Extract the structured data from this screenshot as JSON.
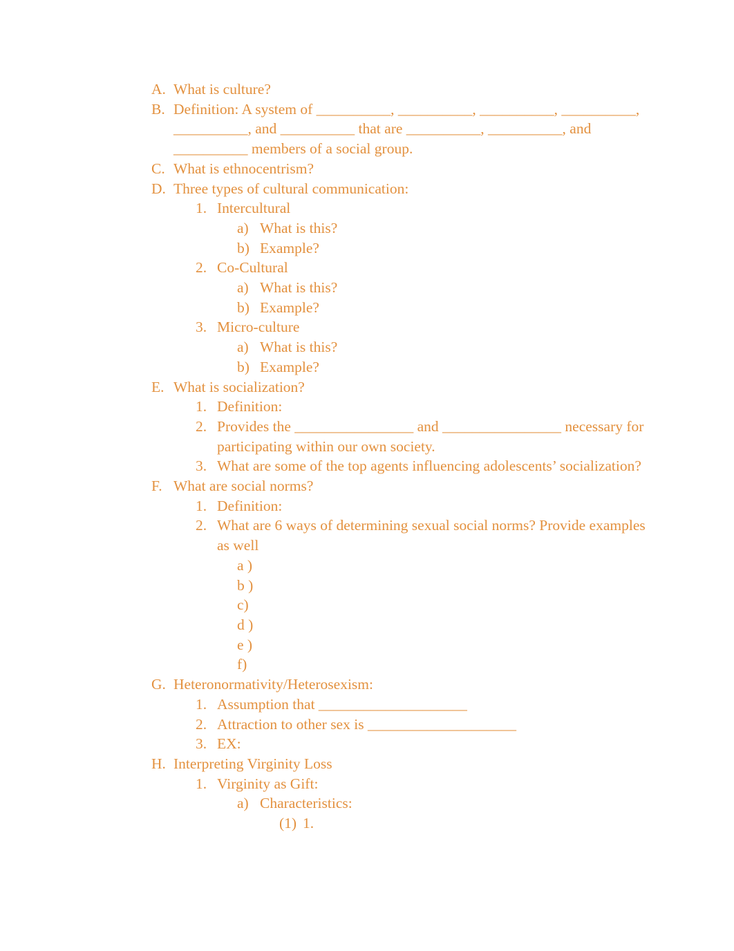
{
  "document": {
    "text_color": "#e3913f",
    "background_color": "#ffffff",
    "blanks": {
      "short": "__________",
      "medium": "________________",
      "long": "____________________"
    },
    "items": [
      {
        "level": 1,
        "marker": "A.",
        "text": "What is culture?"
      },
      {
        "level": 1,
        "marker": "B.",
        "text": "Definition: A system of __________, __________, __________, __________, __________, and __________  that are __________, __________, and __________ members of a social group."
      },
      {
        "level": 1,
        "marker": "C.",
        "text": "What is ethnocentrism?"
      },
      {
        "level": 1,
        "marker": "D.",
        "text": "Three types of cultural communication:"
      },
      {
        "level": 2,
        "marker": "1.",
        "text": "Intercultural"
      },
      {
        "level": 3,
        "marker": "a)",
        "text": "What is this?"
      },
      {
        "level": 3,
        "marker": "b)",
        "text": "Example?"
      },
      {
        "level": 2,
        "marker": "2.",
        "text": "Co-Cultural"
      },
      {
        "level": 3,
        "marker": "a)",
        "text": "What is this?"
      },
      {
        "level": 3,
        "marker": "b)",
        "text": "Example?"
      },
      {
        "level": 2,
        "marker": "3.",
        "text": " Micro-culture"
      },
      {
        "level": 3,
        "marker": "a)",
        "text": "What is this?"
      },
      {
        "level": 3,
        "marker": "b)",
        "text": "Example?"
      },
      {
        "level": 1,
        "marker": "E.",
        "text": "What is socialization?"
      },
      {
        "level": 2,
        "marker": "1.",
        "text": "Definition:"
      },
      {
        "level": 2,
        "marker": "2.",
        "text": "Provides the ________________ and ________________ necessary for participating within our own society."
      },
      {
        "level": 2,
        "marker": "3.",
        "text": "What are some of the top agents influencing adolescents’ socialization?"
      },
      {
        "level": 1,
        "marker": "F.",
        "text": "What are social norms?"
      },
      {
        "level": 2,
        "marker": "1.",
        "text": "Definition:"
      },
      {
        "level": 2,
        "marker": "2.",
        "text": "What are 6 ways of determining sexual social norms? Provide examples as well"
      },
      {
        "level": 3,
        "marker": "a )",
        "text": ""
      },
      {
        "level": 3,
        "marker": "b )",
        "text": ""
      },
      {
        "level": 3,
        "marker": "c)",
        "text": ""
      },
      {
        "level": 3,
        "marker": "d )",
        "text": ""
      },
      {
        "level": 3,
        "marker": "e )",
        "text": ""
      },
      {
        "level": 3,
        "marker": "f)",
        "text": ""
      },
      {
        "level": 1,
        "marker": "G.",
        "text": "Heteronormativity/Heterosexism:"
      },
      {
        "level": 2,
        "marker": "1.",
        "text": "Assumption that ____________________"
      },
      {
        "level": 2,
        "marker": "2.",
        "text": "Attraction to other sex is ____________________"
      },
      {
        "level": 2,
        "marker": "3.",
        "text": "EX:"
      },
      {
        "level": 1,
        "marker": "H.",
        "text": "Interpreting Virginity Loss"
      },
      {
        "level": 2,
        "marker": "1.",
        "text": "Virginity as Gift:"
      },
      {
        "level": 3,
        "marker": "a)",
        "text": "Characteristics:"
      },
      {
        "level": 4,
        "marker": "(1)",
        "text": "1."
      }
    ]
  }
}
